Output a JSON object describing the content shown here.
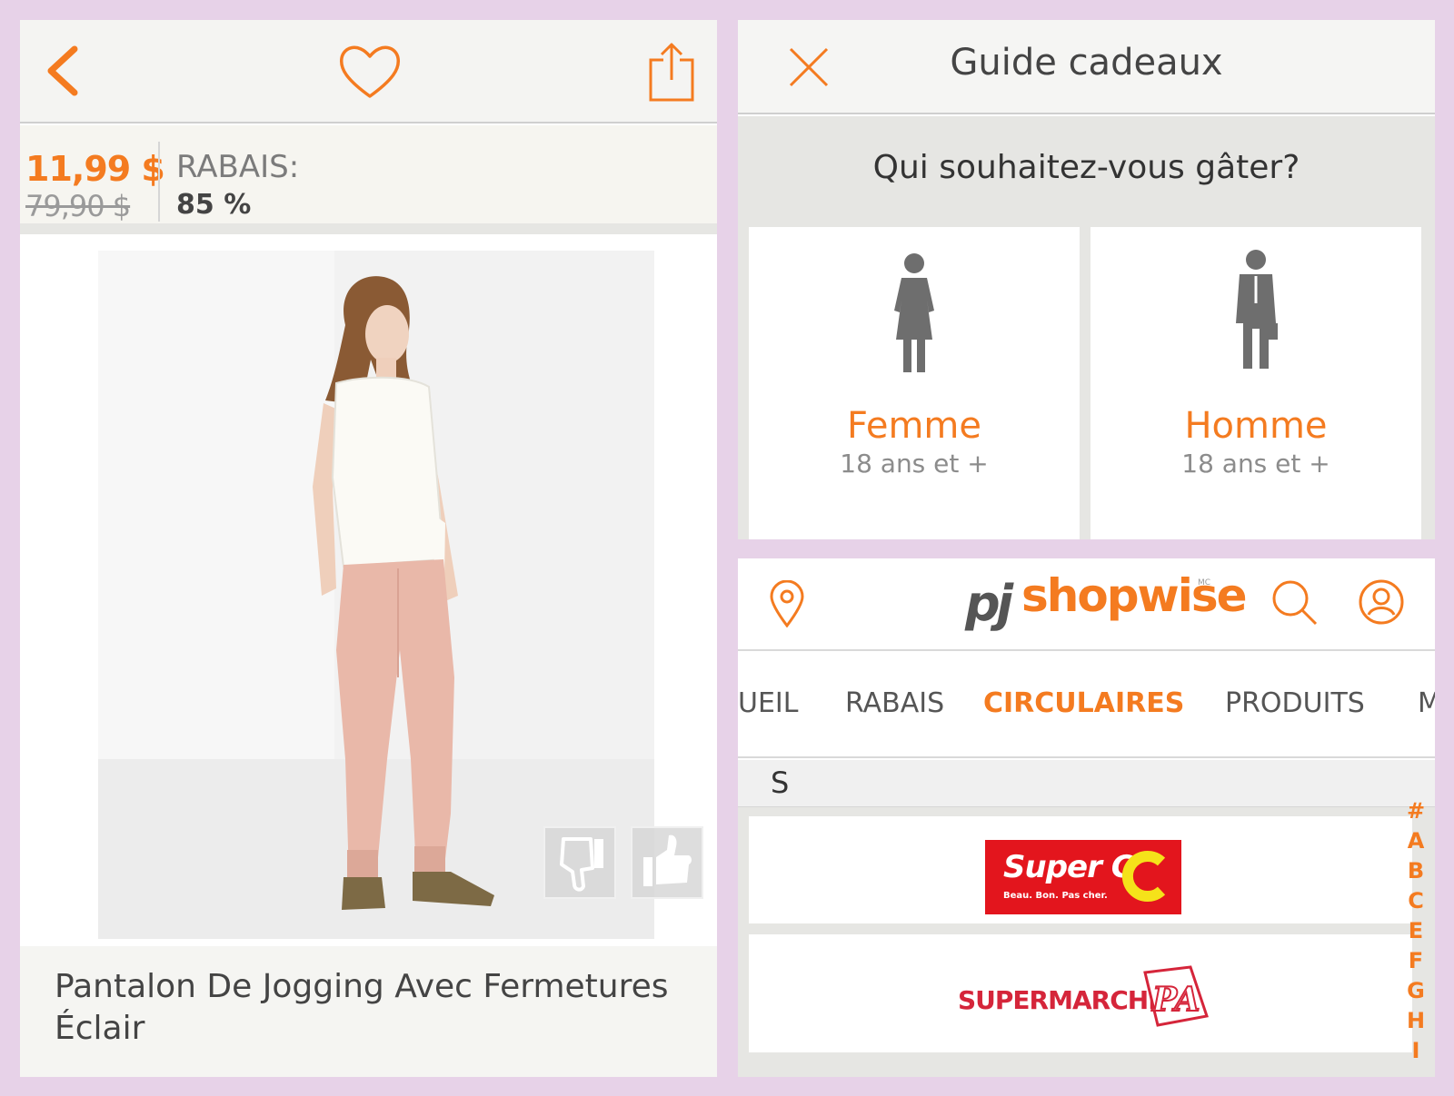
{
  "colors": {
    "accent": "#f47b20",
    "background": "#e7d2e8",
    "superc_red": "#e3151d",
    "supermarche_red": "#d5253a"
  },
  "product": {
    "icons": {
      "back": "chevron-left-icon",
      "favorite": "heart-icon",
      "share": "share-icon",
      "dislike": "thumbs-down-icon",
      "like": "thumbs-up-icon"
    },
    "price_now": "11,99 $",
    "price_old": "79,90 $",
    "discount_label": "RABAIS:",
    "discount_value": "85 %",
    "title": "Pantalon De Jogging Avec Fermetures Éclair"
  },
  "gift_guide": {
    "icons": {
      "close": "close-icon",
      "woman": "woman-icon",
      "man": "man-icon"
    },
    "title": "Guide cadeaux",
    "question": "Qui souhaitez-vous gâter?",
    "options": [
      {
        "name": "Femme",
        "age": "18 ans et +"
      },
      {
        "name": "Homme",
        "age": "18 ans et +"
      }
    ]
  },
  "shopwise": {
    "icons": {
      "location": "location-pin-icon",
      "search": "search-icon",
      "account": "user-icon"
    },
    "logo_prefix": "pj",
    "logo_word": "shopwise",
    "logo_tm": "MC",
    "nav": [
      "UEIL",
      "RABAIS",
      "CIRCULAIRES",
      "PRODUITS",
      "M"
    ],
    "nav_active": "CIRCULAIRES",
    "section": "S",
    "stores": [
      {
        "name": "Super C",
        "tagline": "Beau. Bon. Pas cher."
      },
      {
        "name": "SUPERMARCHÉ PA",
        "wordmark": "SUPERMARCHÉ",
        "badge": "PA"
      }
    ],
    "alphabet": [
      "#",
      "A",
      "B",
      "C",
      "E",
      "F",
      "G",
      "H",
      "I"
    ]
  }
}
